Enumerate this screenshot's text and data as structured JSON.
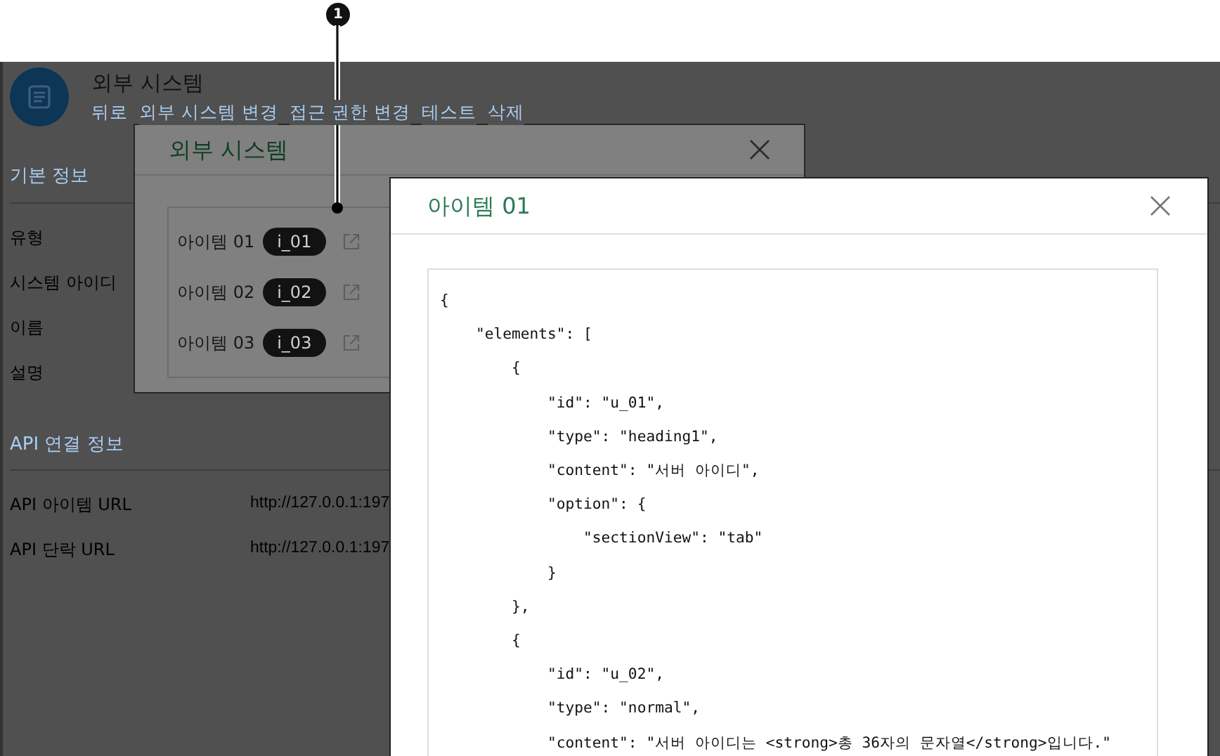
{
  "annotation": {
    "number": "1"
  },
  "page": {
    "title": "외부 시스템",
    "nav_links": [
      "뒤로",
      "외부 시스템 변경",
      "접근 권한 변경",
      "테스트",
      "삭제"
    ],
    "sections": [
      {
        "heading": "기본 정보",
        "fields": [
          {
            "label": "유형"
          },
          {
            "label": "시스템 아이디"
          },
          {
            "label": "이름"
          },
          {
            "label": "설명"
          }
        ]
      },
      {
        "heading": "API 연결 정보",
        "fields": [
          {
            "label": "API 아이템 URL",
            "value": "http://127.0.0.1:197"
          },
          {
            "label": "API 단락 URL",
            "value": "http://127.0.0.1:197"
          }
        ]
      }
    ]
  },
  "dialog": {
    "title": "외부 시스템",
    "items": [
      {
        "label": "아이템 01",
        "code": "i_01"
      },
      {
        "label": "아이템 02",
        "code": "i_02"
      },
      {
        "label": "아이템 03",
        "code": "i_03"
      }
    ]
  },
  "detail_dialog": {
    "title": "아이템 01",
    "code_lines": [
      "{",
      "    \"elements\": [",
      "        {",
      "            \"id\": \"u_01\",",
      "            \"type\": \"heading1\",",
      "            \"content\": \"서버 아이디\",",
      "            \"option\": {",
      "                \"sectionView\": \"tab\"",
      "            }",
      "        },",
      "        {",
      "            \"id\": \"u_02\",",
      "            \"type\": \"normal\",",
      "            \"content\": \"서버 아이디는 <strong>총 36자의 문자열</strong>입니다.\""
    ]
  }
}
